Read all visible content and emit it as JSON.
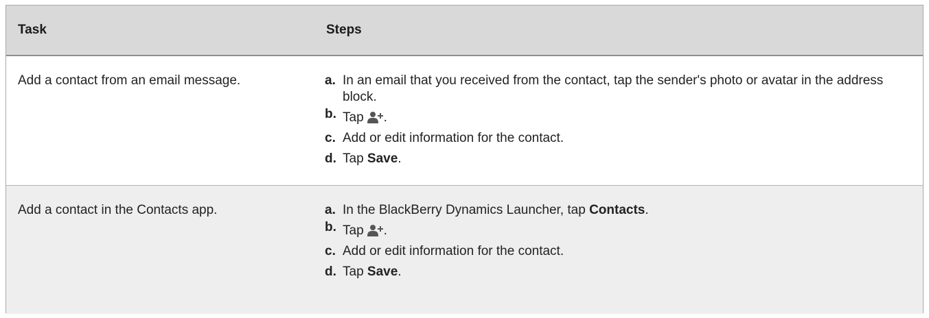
{
  "header": {
    "task": "Task",
    "steps": "Steps"
  },
  "rows": [
    {
      "task": "Add a contact from an email message.",
      "steps": [
        {
          "letter": "a.",
          "text": "In an email that you received from the contact, tap the sender's photo or avatar in the address block."
        },
        {
          "letter": "b.",
          "pre": "Tap",
          "icon": "add-contact-icon",
          "post": "."
        },
        {
          "letter": "c.",
          "text": "Add or edit information for the contact."
        },
        {
          "letter": "d.",
          "pre": "Tap ",
          "bold": "Save",
          "post": "."
        }
      ]
    },
    {
      "task": "Add a contact in the Contacts app.",
      "steps": [
        {
          "letter": "a.",
          "pre": "In the BlackBerry Dynamics Launcher, tap ",
          "bold": "Contacts",
          "post": "."
        },
        {
          "letter": "b.",
          "pre": "Tap",
          "icon": "add-contact-icon",
          "post": "."
        },
        {
          "letter": "c.",
          "text": "Add or edit information for the contact."
        },
        {
          "letter": "d.",
          "pre": "Tap ",
          "bold": "Save",
          "post": "."
        }
      ]
    }
  ],
  "colors": {
    "header_bg": "#d9d9d9",
    "alt_row_bg": "#eeeeee",
    "icon": "#555555"
  }
}
